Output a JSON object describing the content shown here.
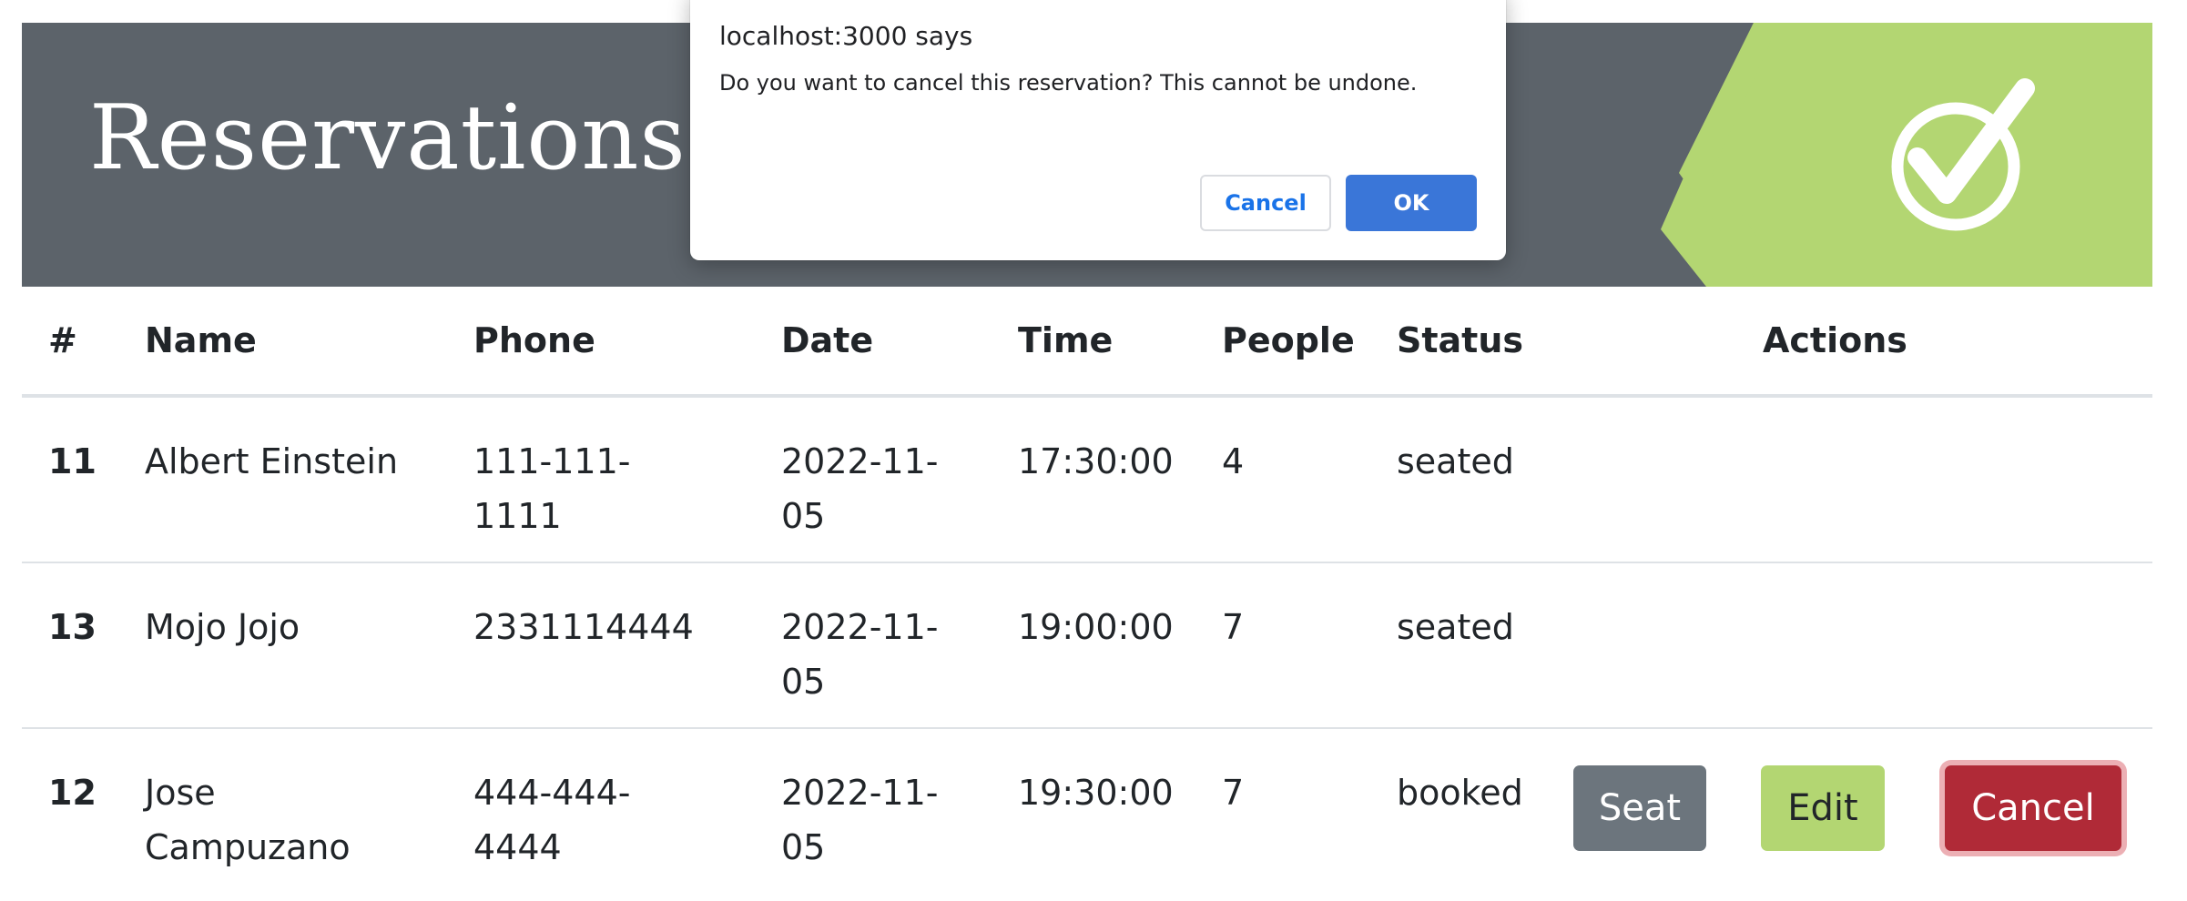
{
  "banner": {
    "title": "Reservations",
    "background_color": "#5c636a",
    "accent_color": "#b3d672",
    "icon": "checkmark-circle-icon"
  },
  "table": {
    "headers": [
      "#",
      "Name",
      "Phone",
      "Date",
      "Time",
      "People",
      "Status",
      "Actions"
    ],
    "rows": [
      {
        "id": "11",
        "name": "Albert Einstein",
        "phone": "111-111-1111",
        "date": "2022-11-05",
        "time": "17:30:00",
        "people": "4",
        "status": "seated",
        "actions": []
      },
      {
        "id": "13",
        "name": "Mojo Jojo",
        "phone": "2331114444",
        "date": "2022-11-05",
        "time": "19:00:00",
        "people": "7",
        "status": "seated",
        "actions": []
      },
      {
        "id": "12",
        "name": "Jose Campuzano",
        "phone": "444-444-4444",
        "date": "2022-11-05",
        "time": "19:30:00",
        "people": "7",
        "status": "booked",
        "actions": [
          "Seat",
          "Edit",
          "Cancel"
        ]
      }
    ]
  },
  "dialog": {
    "title": "localhost:3000 says",
    "message": "Do you want to cancel this reservation? This cannot be undone.",
    "cancel_label": "Cancel",
    "ok_label": "OK",
    "ok_color": "#3a76d8"
  }
}
